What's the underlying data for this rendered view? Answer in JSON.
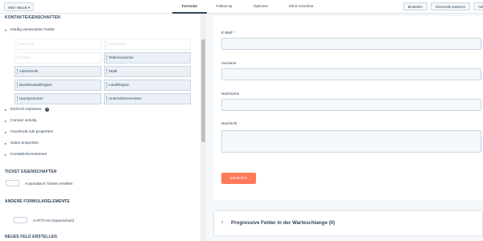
{
  "topbar": {
    "form_select_label": "Mein eBook ▾",
    "tabs": [
      {
        "label": "Formular",
        "active": true
      },
      {
        "label": "Follow-up",
        "active": false
      },
      {
        "label": "Optionen",
        "active": false
      },
      {
        "label": "Stil & Vorschau",
        "active": false
      }
    ],
    "right_buttons": [
      "Einbetten",
      "Shortcode kopieren",
      "Akti"
    ]
  },
  "sidebar": {
    "section_contact": "KONTAKTEIGENSCHAFTEN",
    "frequent_fields_label": "Häufig verwendete Felder",
    "fields": [
      {
        "label": "Vorname",
        "disabled": true
      },
      {
        "label": "Nachname",
        "disabled": true
      },
      {
        "label": "E-Mail",
        "disabled": true
      },
      {
        "label": "Telefonnummer",
        "disabled": false
      },
      {
        "label": "Adresszeile",
        "disabled": false
      },
      {
        "label": "Stadt",
        "disabled": false
      },
      {
        "label": "Bundesstaat/Region",
        "disabled": false
      },
      {
        "label": "Land/Region",
        "disabled": false
      },
      {
        "label": "Handynummer",
        "disabled": false
      },
      {
        "label": "Unternehmensname",
        "disabled": false
      }
    ],
    "groups": [
      {
        "label": "DSGVO-Optionen",
        "info": true
      },
      {
        "label": "Contact activity",
        "info": false
      },
      {
        "label": "Facebook Ads properties",
        "info": false
      },
      {
        "label": "Sales properties",
        "info": false
      },
      {
        "label": "Kontaktinformationen",
        "info": false
      }
    ],
    "section_ticket": "TICKET EIGENSCHAFTEN",
    "ticket_toggle_label": "Automatisch Tickets erstellen",
    "section_other": "ANDERE FORMULARELEMENTE",
    "captcha_label": "CAPTCHA (Spamschutz)",
    "section_new": "NEUES FELD ERSTELLEN"
  },
  "form": {
    "fields": [
      {
        "label": "E-Mail *",
        "type": "input"
      },
      {
        "label": "Vorname",
        "type": "input"
      },
      {
        "label": "Nachname",
        "type": "input"
      },
      {
        "label": "Nachricht",
        "type": "textarea"
      }
    ],
    "submit_label": "Einreichen",
    "progressive_label": "Progressive Felder in der Warteschlange (0)"
  }
}
